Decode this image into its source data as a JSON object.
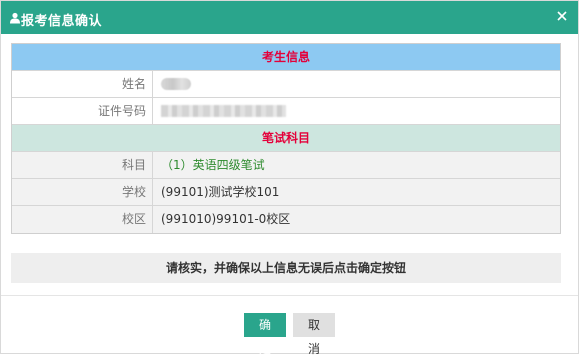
{
  "dialog": {
    "title": "报考信息确认",
    "close_glyph": "×"
  },
  "candidate": {
    "section_title": "考生信息",
    "name_label": "姓名",
    "id_label": "证件号码"
  },
  "exam": {
    "section_title": "笔试科目",
    "subject_label": "科目",
    "subject_value": "（1）英语四级笔试",
    "school_label": "学校",
    "school_value": "(99101)测试学校101",
    "campus_label": "校区",
    "campus_value": "(991010)99101-0校区"
  },
  "notice": "请核实，并确保以上信息无误后点击确定按钮",
  "buttons": {
    "confirm": "确定",
    "cancel": "取消"
  },
  "colors": {
    "accent": "#2aa58c",
    "section_blue": "#8dc9f2",
    "section_teal": "#cde6df",
    "section_title_red": "#e4003a",
    "subject_green": "#2e8b2e"
  },
  "icons": {
    "title": "user-icon",
    "close": "close-icon"
  }
}
